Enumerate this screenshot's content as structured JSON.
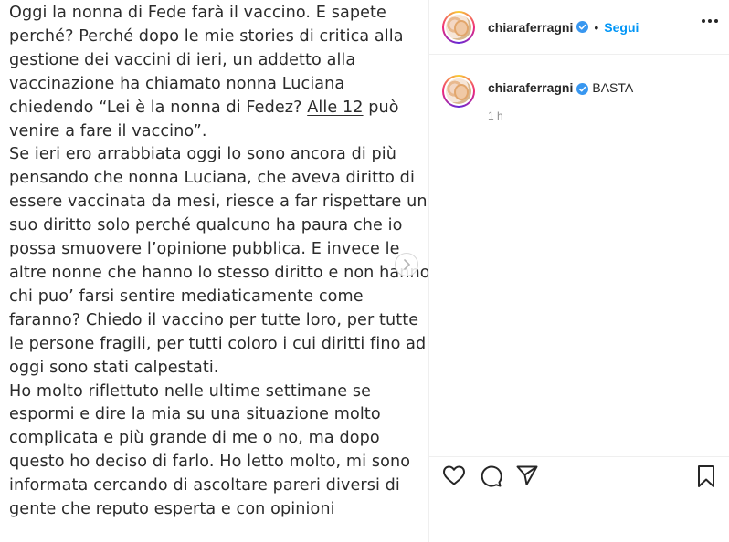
{
  "post_image": {
    "lines": [
      {
        "text": "Oggi la nonna di Fede farà il vaccino. E sapete"
      },
      {
        "text": "perché? Perché dopo le mie stories di critica alla"
      },
      {
        "text": "gestione dei vaccini di ieri, un addetto alla"
      },
      {
        "text": "vaccinazione ha chiamato nonna Luciana"
      },
      {
        "pre": "chiedendo “Lei è la nonna di Fedez? ",
        "underlined": "Alle 12",
        "post": " può"
      },
      {
        "text": "venire a fare il vaccino”."
      },
      {
        "text": "Se ieri ero arrabbiata oggi lo sono ancora di più"
      },
      {
        "text": "pensando che nonna Luciana, che aveva diritto di"
      },
      {
        "text": "essere vaccinata da mesi, riesce a far rispettare un"
      },
      {
        "text": "suo diritto solo perché qualcuno ha paura che io"
      },
      {
        "text": "possa smuovere l’opinione pubblica. E invece le"
      },
      {
        "text": "altre nonne che hanno lo stesso diritto e non hanno"
      },
      {
        "text": "chi puo’ farsi sentire mediaticamente come"
      },
      {
        "text": "faranno? Chiedo il vaccino per tutte loro, per tutte"
      },
      {
        "text": "le persone fragili, per tutti coloro i cui diritti fino ad"
      },
      {
        "text": "oggi sono stati calpestati."
      },
      {
        "text": "Ho molto riflettuto nelle ultime settimane se"
      },
      {
        "text": "espormi e dire la mia su una situazione molto"
      },
      {
        "text": "complicata e più grande di me o no, ma dopo"
      },
      {
        "text": "questo ho deciso di farlo. Ho letto molto, mi sono"
      },
      {
        "text": "informata cercando di ascoltare pareri diversi di"
      },
      {
        "text": "gente che reputo esperta e con opinioni"
      }
    ]
  },
  "header": {
    "username": "chiaraferragni",
    "separator": "•",
    "follow_label": "Segui"
  },
  "caption": {
    "username": "chiaraferragni",
    "text": "BASTA",
    "time": "1 h"
  },
  "colors": {
    "accent": "#0095f6",
    "verified": "#3897f0",
    "muted": "#8e8e8e"
  },
  "icons": {
    "like": "heart-icon",
    "comment": "comment-icon",
    "share": "paper-plane-icon",
    "save": "bookmark-icon",
    "more": "more-options-icon",
    "next": "chevron-right-icon",
    "verified": "verified-badge-icon"
  }
}
